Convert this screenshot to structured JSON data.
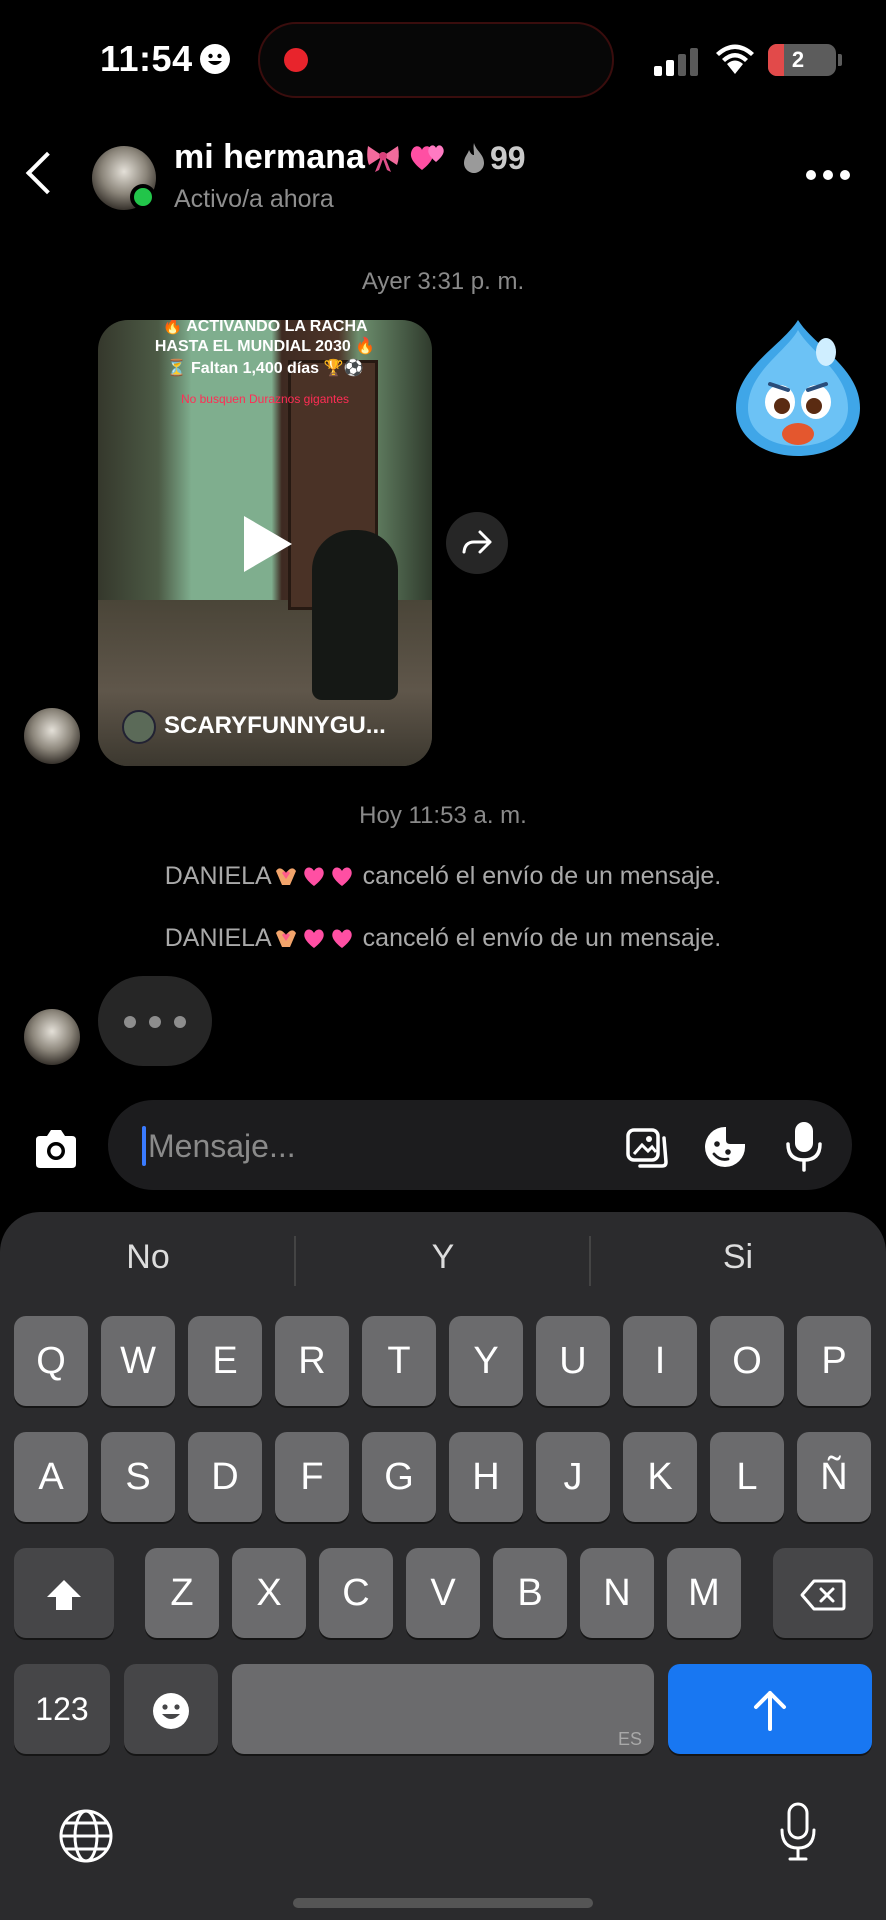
{
  "status_bar": {
    "time": "11:54",
    "battery": "2",
    "icons": [
      "smile-icon",
      "recording-dot-icon",
      "signal-icon",
      "wifi-icon",
      "battery-icon"
    ]
  },
  "header": {
    "contact_name": "mi hermana",
    "streak": "99",
    "status": "Activo/a ahora",
    "icons": [
      "back-icon",
      "avatar",
      "bow-emoji",
      "hearts-emoji",
      "flame-icon",
      "more-icon"
    ]
  },
  "messages": {
    "timestamp_1": "Ayer 3:31 p. m.",
    "video": {
      "caption_1": "🔥 ACTIVANDO LA RACHA",
      "caption_2": "HASTA EL MUNDIAL 2030 🔥",
      "caption_3": "⏳ Faltan 1,400 días 🏆⚽",
      "caption_4": "No busquen Duraznos gigantes",
      "username": "SCARYFUNNYGU..."
    },
    "timestamp_2": "Hoy 11:53 a. m.",
    "system_1": {
      "name": "DANIELA",
      "text": "canceló el envío de un mensaje."
    },
    "system_2": {
      "name": "DANIELA",
      "text": "canceló el envío de un mensaje."
    }
  },
  "composer": {
    "placeholder": "Mensaje...",
    "icons": [
      "camera-icon",
      "gallery-icon",
      "sticker-icon",
      "microphone-icon"
    ]
  },
  "keyboard": {
    "suggestions": [
      "No",
      "Y",
      "Si"
    ],
    "row1": [
      "Q",
      "W",
      "E",
      "R",
      "T",
      "Y",
      "U",
      "I",
      "O",
      "P"
    ],
    "row2": [
      "A",
      "S",
      "D",
      "F",
      "G",
      "H",
      "J",
      "K",
      "L",
      "Ñ"
    ],
    "row3": [
      "Z",
      "X",
      "C",
      "V",
      "B",
      "N",
      "M"
    ],
    "numbers_key": "123",
    "space_lang": "ES",
    "icons": [
      "shift-icon",
      "backspace-icon",
      "emoji-icon",
      "send-arrow-icon",
      "globe-icon",
      "dictation-mic-icon"
    ]
  },
  "colors": {
    "accent_blue": "#1877f2",
    "online_green": "#22c54a",
    "key_bg": "#6b6b6d",
    "keyboard_bg": "#2b2b2d"
  }
}
